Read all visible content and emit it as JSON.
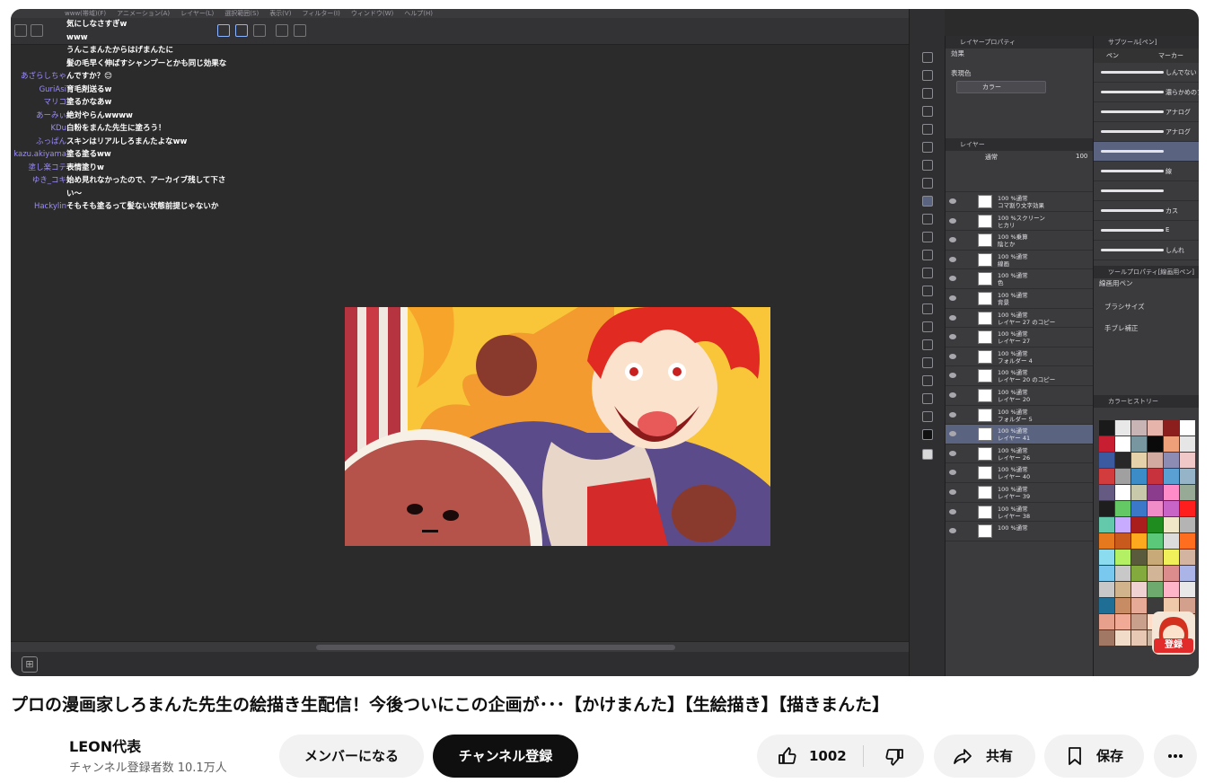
{
  "video": {
    "menu": [
      "www(帯域)(F)",
      "アニメーション(A)",
      "レイヤー(L)",
      "選択範囲(S)",
      "表示(V)",
      "フィルター(I)",
      "ウィンドウ(W)",
      "ヘルプ(H)"
    ],
    "chat": [
      {
        "name": "",
        "message": "気にしなさすぎw"
      },
      {
        "name": "",
        "message": "www"
      },
      {
        "name": "",
        "message": "うんこまんたからはげまんたに"
      },
      {
        "name": "",
        "message": "髪の毛早く伸ばすシャンプーとかも同じ効果な"
      },
      {
        "name": "あざらしちゃ",
        "message": "んですか？😊"
      },
      {
        "name": "GuriAsi",
        "message": "育毛剤送るw"
      },
      {
        "name": "マリコ",
        "message": "塗るかなあw"
      },
      {
        "name": "あーみぃ",
        "message": "絶対やらんwwww"
      },
      {
        "name": "KDu",
        "message": "白粉をまんた先生に塗ろう！"
      },
      {
        "name": "ふっぱん",
        "message": "スキンはリアルしろまんたよなww"
      },
      {
        "name": "kazu.akiyama",
        "message": "塗る塗るww"
      },
      {
        "name": "塗し楽コテ",
        "message": "表情塗りw"
      },
      {
        "name": "ゆき_コキ",
        "message": "始め見れなかったので、アーカイブ残して下さ"
      },
      {
        "name": "",
        "message": "い〜"
      },
      {
        "name": "Hackylin",
        "message": "そもそも塗るって髪ない状態前提じゃないか"
      }
    ],
    "panels": {
      "layer_property_title": "レイヤープロパティ",
      "effect_label": "効果",
      "expression_label": "表現色",
      "expression_value": "カラー",
      "layer_title": "レイヤー",
      "blend_mode": "通常",
      "opacity": "100",
      "layers": [
        "100 %通常\nコマ割り文字効果",
        "100 %スクリーン\nヒカリ",
        "100 %乗算\n陰とか",
        "100 %通常\n線画",
        "100 %通常\n色",
        "100 %通常\n背景",
        "100 %通常\nレイヤー 27 のコピー",
        "100 %通常\nレイヤー 27",
        "100 %通常\nフォルダー 4",
        "100 %通常\nレイヤー 20 のコピー",
        "100 %通常\nレイヤー 20",
        "100 %通常\nフォルダー 5",
        "100 %通常\nレイヤー 41",
        "100 %通常\nレイヤー 26",
        "100 %通常\nレイヤー 40",
        "100 %通常\nレイヤー 39",
        "100 %通常\nレイヤー 38",
        "100 %通常"
      ],
      "selected_layer_index": 12,
      "subtool_title": "サブツール[ペン]",
      "subtool_tabs": [
        "ペン",
        "マーカー"
      ],
      "brushes": [
        "しんでない",
        "濃らかめのアナログ風線",
        "アナログ",
        "アナログ",
        "",
        "線",
        "",
        "カス",
        "E",
        "しんれ"
      ],
      "tool_property_title": "ツールプロパティ[線画用ペン]",
      "tool_property_brush": "線画用ペン",
      "brush_size_label": "ブラシサイズ",
      "stabilizer_label": "手ブレ補正",
      "color_history_title": "カラーヒストリー",
      "swatch_colors": [
        "#1a1a1a",
        "#e8e8e8",
        "#c8b4b4",
        "#e6b4aa",
        "#8c1e1e",
        "#ffffff",
        "#c81e32",
        "#ffffff",
        "#7896a0",
        "#0a0a0a",
        "#f0a078",
        "#e6e6e6",
        "#3c5aa0",
        "#282828",
        "#e6d2aa",
        "#d2aaa0",
        "#8c8cb4",
        "#f0c8c8",
        "#d23c3c",
        "#a0a0a0",
        "#3c8cc8",
        "#c8323c",
        "#5aa0d2",
        "#96b4c8",
        "#645a82",
        "#ffffff",
        "#c8c8aa",
        "#8c3c8c",
        "#ff8cc8",
        "#96aa96",
        "#1e1e1e",
        "#64c864",
        "#3c78c8",
        "#f08cc8",
        "#c864c8",
        "#ff1e1e",
        "#64c8aa",
        "#c8aaff",
        "#aa1e1e",
        "#1e8c1e",
        "#f0e6c8",
        "#b4b4b4",
        "#e6781e",
        "#c85a1e",
        "#ffaa1e",
        "#5ac878",
        "#dcdcdc",
        "#ff6e1e",
        "#8cdcf0",
        "#b4f064",
        "#5a5a3c",
        "#c8aa78",
        "#f0f05a",
        "#d2b4a0",
        "#78c8f0",
        "#c8c8c8",
        "#82aa3c",
        "#d2b496",
        "#dc8c8c",
        "#aab4e6",
        "#c8c8c8",
        "#d2b48c",
        "#f0d2d2",
        "#6eaa6e",
        "#ffb4c8",
        "#e8e8e8",
        "#1e6e96",
        "#c88c64",
        "#e6aa96",
        "#3c3c3c",
        "#f0c8aa",
        "#d2a08c",
        "#e6a08c",
        "#f0aa96",
        "#c8a08c",
        "#ffdcc8",
        "#b48c78",
        "#dcbca0",
        "#a07864",
        "#f0dcc8",
        "#e6c8b4",
        "#c8b4a0",
        "#f5d2be",
        "#ffe6d2"
      ],
      "subscribe_overlay": "登録"
    }
  },
  "title": "プロの漫画家しろまんた先生の絵描き生配信！今後ついにこの企画が･･･【かけまんた】【生絵描き】【描きまんた】",
  "channel": {
    "name": "LEON代表",
    "subscribers": "チャンネル登録者数 10.1万人"
  },
  "buttons": {
    "join": "メンバーになる",
    "subscribe": "チャンネル登録",
    "like_count": "1002",
    "share": "共有",
    "save": "保存"
  }
}
